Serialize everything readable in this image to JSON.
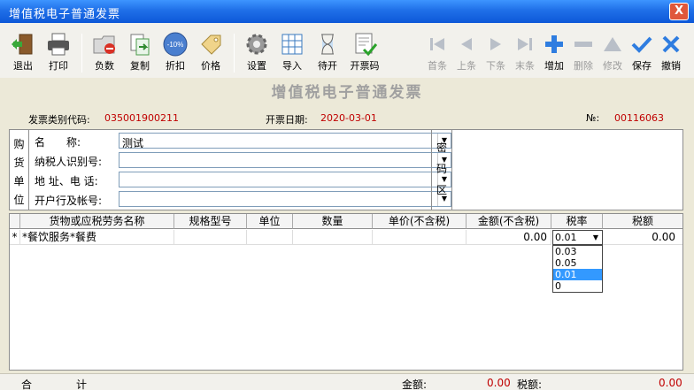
{
  "window": {
    "title": "增值税电子普通发票",
    "close_label": "X"
  },
  "toolbar": {
    "items": [
      {
        "label": "退出",
        "icon": "exit-door-icon"
      },
      {
        "label": "打印",
        "icon": "printer-icon"
      },
      {
        "label": "负数",
        "icon": "folder-minus-icon"
      },
      {
        "label": "复制",
        "icon": "copy-doc-icon"
      },
      {
        "label": "折扣",
        "icon": "discount-badge-icon",
        "badge": "-10%"
      },
      {
        "label": "价格",
        "icon": "price-tag-icon"
      },
      {
        "label": "设置",
        "icon": "gear-icon"
      },
      {
        "label": "导入",
        "icon": "grid-import-icon"
      },
      {
        "label": "待开",
        "icon": "hourglass-icon"
      },
      {
        "label": "开票码",
        "icon": "invoice-check-icon"
      },
      {
        "label": "首条",
        "icon": "first-record-icon"
      },
      {
        "label": "上条",
        "icon": "prev-record-icon"
      },
      {
        "label": "下条",
        "icon": "next-record-icon"
      },
      {
        "label": "末条",
        "icon": "last-record-icon"
      },
      {
        "label": "增加",
        "icon": "plus-icon"
      },
      {
        "label": "删除",
        "icon": "minus-icon"
      },
      {
        "label": "修改",
        "icon": "triangle-up-icon"
      },
      {
        "label": "保存",
        "icon": "checkmark-icon"
      },
      {
        "label": "撤销",
        "icon": "undo-icon"
      }
    ]
  },
  "invoice": {
    "title": "增值税电子普通发票",
    "type_code_label": "发票类别代码:",
    "type_code": "035001900211",
    "date_label": "开票日期:",
    "date": "2020-03-01",
    "no_label": "№:",
    "no": "00116063"
  },
  "buyer": {
    "section_label": [
      "购",
      "货",
      "单",
      "位"
    ],
    "fields": [
      {
        "label": "名　　称:",
        "value": "测试"
      },
      {
        "label": "纳税人识别号:",
        "value": ""
      },
      {
        "label": "地 址、电 话:",
        "value": ""
      },
      {
        "label": "开户行及帐号:",
        "value": ""
      }
    ],
    "cipher_label": [
      "密",
      "码",
      "区"
    ]
  },
  "table": {
    "headers": [
      "货物或应税劳务名称",
      "规格型号",
      "单位",
      "数量",
      "单价(不含税)",
      "金额(不含税)",
      "税率",
      "税额"
    ],
    "row": {
      "marker": "*",
      "name": "*餐饮服务*餐费",
      "spec": "",
      "unit": "",
      "qty": "",
      "price": "",
      "amount": "0.00",
      "rate": "0.01",
      "tax": "0.00"
    },
    "rate_options": [
      "0.03",
      "0.05",
      "0.01",
      "0"
    ],
    "rate_selected_index": 2
  },
  "footer": {
    "total_label_1": "合",
    "total_label_2": "计",
    "amount_label": "金额:",
    "amount": "0.00",
    "tax_label": "税额:",
    "tax": "0.00"
  }
}
